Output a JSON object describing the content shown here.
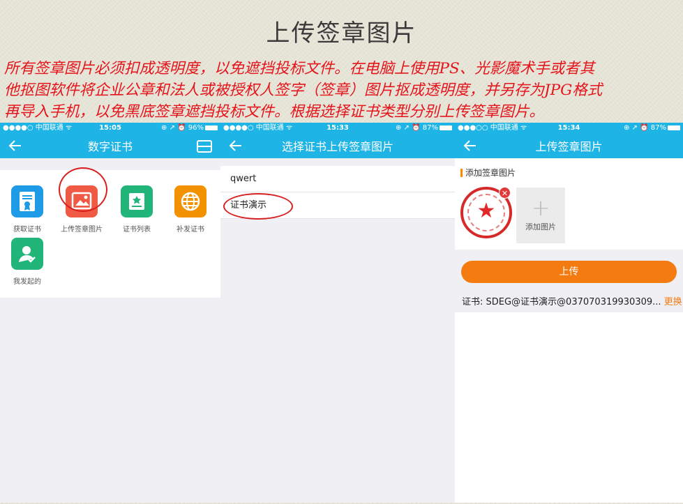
{
  "slide": {
    "title": "上传签章图片",
    "description_lines": [
      "所有签章图片必须扣成透明度，以免遮挡投标文件。在电脑上使用PS、光影魔术手或者其",
      "他抠图软件将企业公章和法人或被授权人签字（签章）图片抠成透明度，并另存为JPG格式",
      "再导入手机，以免黑底签章遮挡投标文件。根据选择证书类型分别上传签章图片。"
    ]
  },
  "phone1": {
    "status": {
      "carrier": "●●●●○ 中国联通 ᯤ",
      "time": "15:05",
      "right": "⊕ ↗ ⏰ 96%"
    },
    "title": "数字证书",
    "apps": [
      {
        "label": "获取证书",
        "icon": "certificate-icon",
        "color": "#1e9be6"
      },
      {
        "label": "上传签章图片",
        "icon": "image-upload-icon",
        "color": "#f05a45"
      },
      {
        "label": "证书列表",
        "icon": "list-star-icon",
        "color": "#21b57a"
      },
      {
        "label": "补发证书",
        "icon": "globe-icon",
        "color": "#f39200"
      },
      {
        "label": "我发起的",
        "icon": "user-check-icon",
        "color": "#21b57a"
      }
    ]
  },
  "phone2": {
    "status": {
      "carrier": "●●●●○ 中国联通 ᯤ",
      "time": "15:33",
      "right": "⊕ ↗ ⏰ 87%"
    },
    "title": "选择证书上传签章图片",
    "certs": [
      "qwert",
      "证书演示"
    ]
  },
  "phone3": {
    "status": {
      "carrier": "●●●○○ 中国联通 ᯤ",
      "time": "15:34",
      "right": "⊕ ↗ ⏰ 87%"
    },
    "title": "上传签章图片",
    "section": "添加签章图片",
    "add_label": "添加图片",
    "remove": "✕",
    "upload": "上传",
    "cert_info": "证书: SDEG@证书演示@037070319930309...",
    "change": "更换"
  },
  "colors": {
    "nav": "#1fb4e6",
    "accent": "#f47b0f",
    "highlight": "#d81e1e",
    "desc": "#e5141c"
  }
}
